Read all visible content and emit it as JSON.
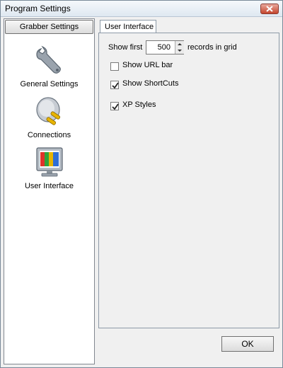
{
  "window": {
    "title": "Program Settings"
  },
  "sidebar": {
    "group_button": "Grabber Settings",
    "items": [
      {
        "label": "General Settings",
        "icon": "wrench-icon"
      },
      {
        "label": "Connections",
        "icon": "plug-icon"
      },
      {
        "label": "User Interface",
        "icon": "monitor-icon"
      }
    ]
  },
  "tabs": [
    {
      "label": "User Interface"
    }
  ],
  "settings": {
    "show_first_label": "Show first",
    "records_value": "500",
    "records_suffix": "records in grid",
    "checkboxes": [
      {
        "label": "Show URL bar",
        "checked": false
      },
      {
        "label": "Show ShortCuts",
        "checked": true
      },
      {
        "label": "XP Styles",
        "checked": true
      }
    ]
  },
  "footer": {
    "ok_label": "OK"
  },
  "colors": {
    "accent": "#c4452d",
    "panel_bg": "#f0f0f0"
  }
}
